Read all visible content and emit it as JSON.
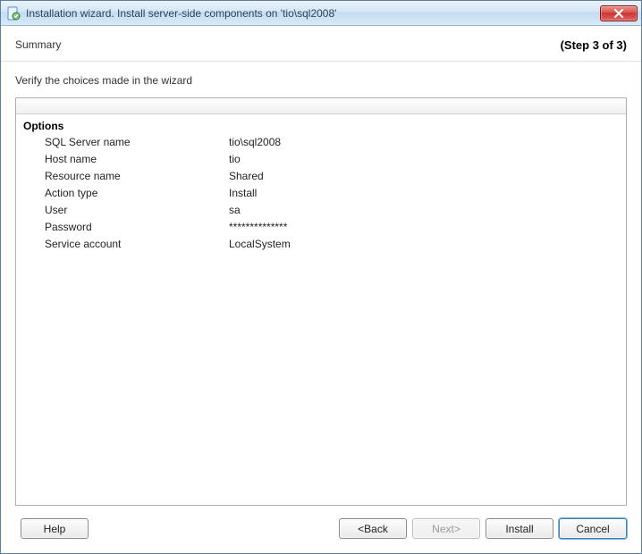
{
  "window": {
    "title": "Installation wizard. Install server-side components on 'tio\\sql2008'"
  },
  "header": {
    "summary": "Summary",
    "step": "(Step 3 of 3)"
  },
  "instruction": "Verify the choices made in the wizard",
  "options": {
    "heading": "Options",
    "rows": [
      {
        "label": "SQL Server name",
        "value": "tio\\sql2008"
      },
      {
        "label": "Host name",
        "value": "tio"
      },
      {
        "label": "Resource name",
        "value": "Shared"
      },
      {
        "label": "Action type",
        "value": "Install"
      },
      {
        "label": "User",
        "value": "sa"
      },
      {
        "label": "Password",
        "value": "**************"
      },
      {
        "label": "Service account",
        "value": "LocalSystem"
      }
    ]
  },
  "footer": {
    "help": "Help",
    "back": "<Back",
    "next": "Next>",
    "install": "Install",
    "cancel": "Cancel"
  }
}
